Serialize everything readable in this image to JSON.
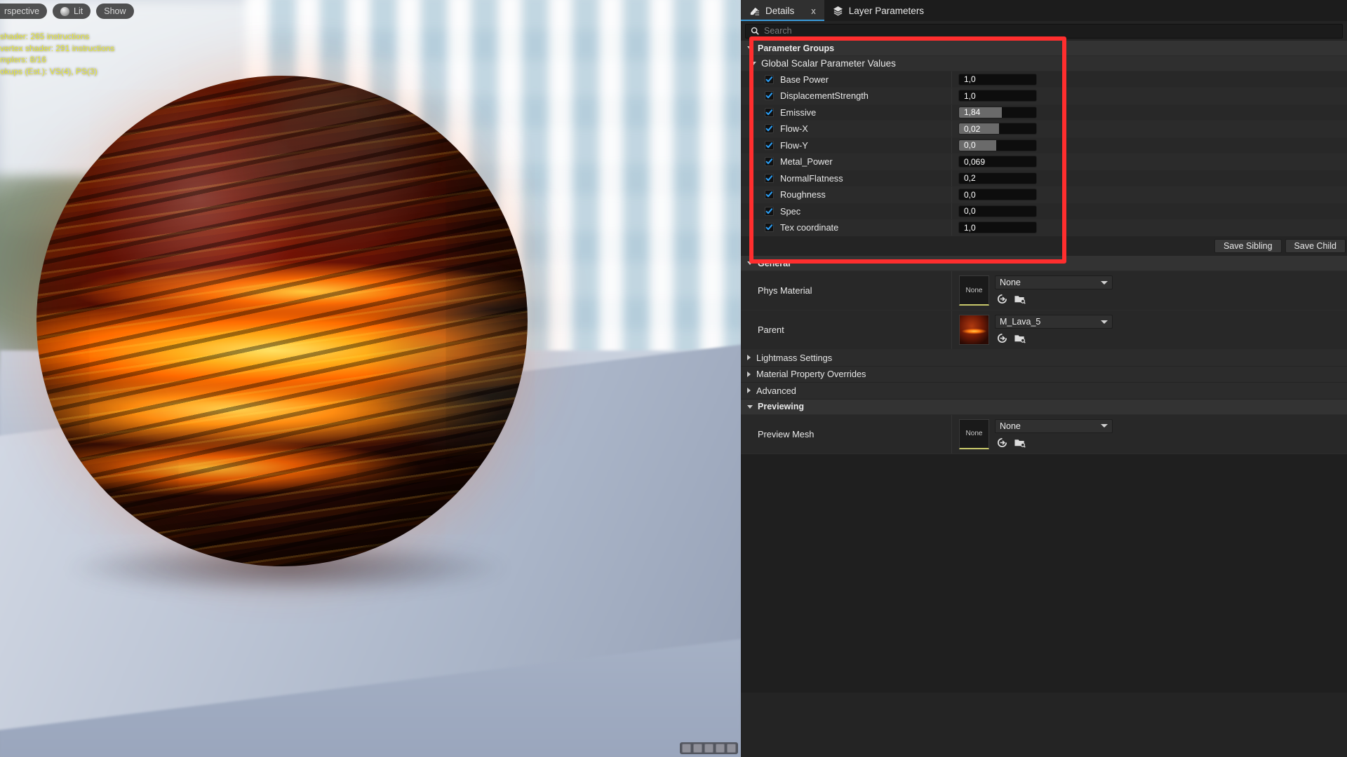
{
  "viewport": {
    "toolbar": [
      {
        "label": "rspective",
        "icon": "perspective-icon"
      },
      {
        "label": "Lit",
        "icon": "lit-sphere-icon"
      },
      {
        "label": "Show",
        "icon": "show-icon"
      }
    ],
    "stats_lines": [
      "shader: 265 instructions",
      "vertex shader: 291 instructions",
      "mplers: 8/16",
      "okups (Est.): VS(4), PS(3)"
    ],
    "stats_color": "#e9e93a"
  },
  "panel": {
    "tabs": [
      {
        "label": "Details",
        "icon": "details-icon",
        "active": true,
        "closable": true,
        "close_label": "x"
      },
      {
        "label": "Layer Parameters",
        "icon": "layers-icon",
        "active": false,
        "closable": false
      }
    ],
    "search": {
      "placeholder": "Search",
      "icon": "search-icon",
      "value": ""
    },
    "parameter_groups": {
      "label": "Parameter Groups",
      "expanded": true,
      "group": {
        "label": "Global Scalar Parameter Values",
        "expanded": true,
        "rows": [
          {
            "name": "Base Power",
            "checked": true,
            "value": "1,0",
            "fill_pct": 0
          },
          {
            "name": "DisplacementStrength",
            "checked": true,
            "value": "1,0",
            "fill_pct": 0
          },
          {
            "name": "Emissive",
            "checked": true,
            "value": "1,84",
            "fill_pct": 55
          },
          {
            "name": "Flow-X",
            "checked": true,
            "value": "0,02",
            "fill_pct": 52
          },
          {
            "name": "Flow-Y",
            "checked": true,
            "value": "0,0",
            "fill_pct": 48
          },
          {
            "name": "Metal_Power",
            "checked": true,
            "value": "0,069",
            "fill_pct": 0
          },
          {
            "name": "NormalFlatness",
            "checked": true,
            "value": "0,2",
            "fill_pct": 0
          },
          {
            "name": "Roughness",
            "checked": true,
            "value": "0,0",
            "fill_pct": 0
          },
          {
            "name": "Spec",
            "checked": true,
            "value": "0,0",
            "fill_pct": 0
          },
          {
            "name": "Tex coordinate",
            "checked": true,
            "value": "1,0",
            "fill_pct": 0
          }
        ]
      }
    },
    "save_buttons": [
      {
        "label": "Save Sibling"
      },
      {
        "label": "Save Child"
      }
    ],
    "general": {
      "label": "General",
      "expanded": true,
      "rows": [
        {
          "name": "Phys Material",
          "thumb_text": "None",
          "thumb_kind": "none",
          "combo_value": "None",
          "icons": [
            "browse-to-asset-icon",
            "use-selected-asset-icon"
          ]
        },
        {
          "name": "Parent",
          "thumb_text": "",
          "thumb_kind": "lava",
          "combo_value": "M_Lava_5",
          "icons": [
            "browse-to-asset-icon",
            "use-selected-asset-icon"
          ]
        }
      ]
    },
    "collapsed_sections": [
      {
        "label": "Lightmass Settings",
        "expanded": false
      },
      {
        "label": "Material Property Overrides",
        "expanded": false
      },
      {
        "label": "Advanced",
        "expanded": false
      }
    ],
    "previewing": {
      "label": "Previewing",
      "expanded": true,
      "rows": [
        {
          "name": "Preview Mesh",
          "thumb_text": "None",
          "thumb_kind": "none",
          "combo_value": "None",
          "icons": [
            "browse-to-asset-icon",
            "use-selected-asset-icon"
          ]
        }
      ]
    }
  },
  "highlight": {
    "name": "red-annotation-box",
    "color": "#ff2e2e"
  }
}
